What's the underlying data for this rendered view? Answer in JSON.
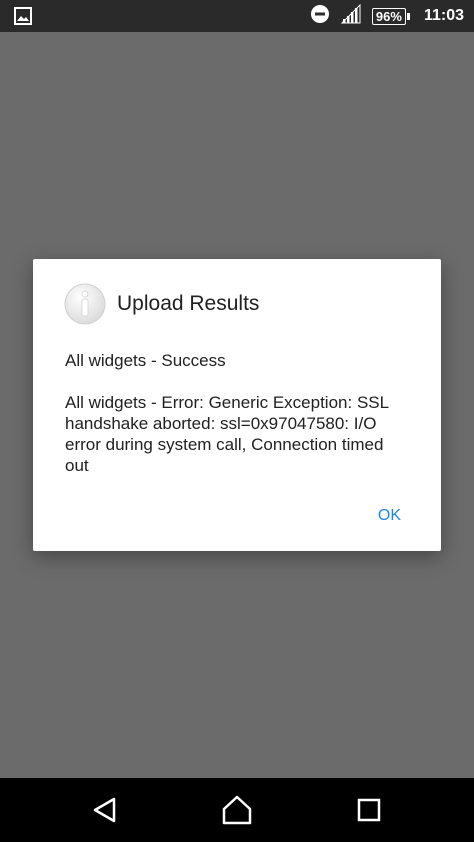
{
  "status_bar": {
    "notification_icon": "image-icon",
    "dnd_icon": "do-not-disturb-icon",
    "signal_icon": "signal-icon",
    "battery_level": "96%",
    "time": "11:03"
  },
  "dialog": {
    "icon": "info-icon",
    "title": "Upload Results",
    "message": "All widgets - Success\n\nAll widgets - Error: Generic Exception: SSL handshake aborted: ssl=0x97047580: I/O error during system call, Connection timed out",
    "ok_label": "OK"
  },
  "nav_bar": {
    "back_icon": "back-icon",
    "home_icon": "home-icon",
    "recents_icon": "recents-icon"
  },
  "colors": {
    "scrim": "#6b6b6b",
    "status_bar": "#2a2a2a",
    "accent": "#1e88e5",
    "nav_bar": "#000000"
  }
}
